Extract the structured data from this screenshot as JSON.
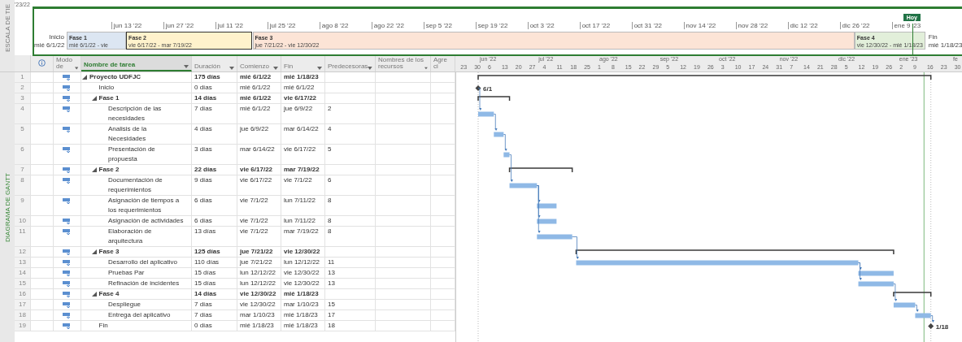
{
  "side_labels": {
    "timeline": "ESCALA DE TIE",
    "gantt": "DIAGRAMA DE GANTT"
  },
  "timeline": {
    "cut_label": "'23/22",
    "today": "Hoy",
    "ticks": [
      "jun 13 '22",
      "jun 27 '22",
      "jul 11 '22",
      "jul 25 '22",
      "ago 8 '22",
      "ago 22 '22",
      "sep 5 '22",
      "sep 19 '22",
      "oct 3 '22",
      "oct 17 '22",
      "oct 31 '22",
      "nov 14 '22",
      "nov 28 '22",
      "dic 12 '22",
      "dic 26 '22",
      "ene 9 '23"
    ],
    "start": {
      "label": "Inicio",
      "date": "mié 6/1/22"
    },
    "end": {
      "label": "Fin",
      "date": "mié 1/18/23"
    },
    "bars": [
      {
        "name": "Fase 1",
        "dates": "mié 6/1/22 - vie",
        "color": "#dce6f2",
        "selected": false
      },
      {
        "name": "Fase 2",
        "dates": "vie 6/17/22 - mar 7/19/22",
        "color": "#fff2cc",
        "selected": true
      },
      {
        "name": "Fase 3",
        "dates": "jue 7/21/22 - vie 12/30/22",
        "color": "#fce4d6",
        "selected": false
      },
      {
        "name": "Fase 4",
        "dates": "vie 12/30/22 - mié 1/18/23",
        "color": "#e2efda",
        "selected": false
      }
    ]
  },
  "columns": [
    {
      "kind": "info"
    },
    {
      "kind": "text",
      "label": "Modo de",
      "filter": true,
      "selected": false
    },
    {
      "kind": "text",
      "label": "Nombre de tarea",
      "filter": true,
      "selected": true
    },
    {
      "kind": "text",
      "label": "Duración",
      "filter": true,
      "selected": false
    },
    {
      "kind": "text",
      "label": "Comienzo",
      "filter": true,
      "selected": false
    },
    {
      "kind": "text",
      "label": "Fin",
      "filter": true,
      "selected": false
    },
    {
      "kind": "text",
      "label": "Predecesoras",
      "filter": true,
      "selected": false
    },
    {
      "kind": "text",
      "label": "Nombres de los recursos",
      "filter": true,
      "selected": false
    },
    {
      "kind": "text",
      "label": "Agre ci",
      "filter": false,
      "selected": false
    }
  ],
  "gantt_header": {
    "months": [
      "jun '22",
      "jul '22",
      "ago '22",
      "sep '22",
      "oct '22",
      "nov '22",
      "dic '22",
      "ene '23",
      "fe"
    ],
    "weeks": [
      "23",
      "30",
      "6",
      "13",
      "20",
      "27",
      "4",
      "11",
      "18",
      "25",
      "1",
      "8",
      "15",
      "22",
      "29",
      "5",
      "12",
      "19",
      "26",
      "3",
      "10",
      "17",
      "24",
      "31",
      "7",
      "14",
      "21",
      "28",
      "5",
      "12",
      "19",
      "26",
      "2",
      "9",
      "16",
      "23",
      "30"
    ]
  },
  "tasks": [
    {
      "id": "1",
      "name": "Proyecto UDFJC",
      "duration": "175 días",
      "start": "mié 6/1/22",
      "finish": "mié 1/18/23",
      "kind": "summary",
      "expanded": true,
      "children": [
        {
          "id": "2",
          "name": "Inicio",
          "duration": "0 días",
          "start": "mié 6/1/22",
          "finish": "mié 6/1/22",
          "kind": "milestone",
          "bar_label": "6/1"
        },
        {
          "id": "3",
          "name": "Fase 1",
          "duration": "14 días",
          "start": "mié 6/1/22",
          "finish": "vie 6/17/22",
          "kind": "summary",
          "expanded": true,
          "children": [
            {
              "id": "4",
              "name": "Descripción de las necesidades",
              "duration": "7 días",
              "start": "mié 6/1/22",
              "finish": "jue 6/9/22",
              "predecessors": "2",
              "kind": "task"
            },
            {
              "id": "5",
              "name": "Analisis de la Necesidades",
              "duration": "4 días",
              "start": "jue 6/9/22",
              "finish": "mar 6/14/22",
              "predecessors": "4",
              "kind": "task"
            },
            {
              "id": "6",
              "name": "Presentación de propuesta",
              "duration": "3 días",
              "start": "mar 6/14/22",
              "finish": "vie 6/17/22",
              "predecessors": "5",
              "kind": "task"
            }
          ]
        },
        {
          "id": "7",
          "name": "Fase 2",
          "duration": "22 días",
          "start": "vie 6/17/22",
          "finish": "mar 7/19/22",
          "kind": "summary",
          "expanded": true,
          "children": [
            {
              "id": "8",
              "name": "Documentación de requerimientos",
              "duration": "9 días",
              "start": "vie 6/17/22",
              "finish": "vie 7/1/22",
              "predecessors": "6",
              "kind": "task"
            },
            {
              "id": "9",
              "name": "Asignación de tiempos a los requerimientos",
              "duration": "6 días",
              "start": "vie 7/1/22",
              "finish": "lun 7/11/22",
              "predecessors": "8",
              "kind": "task"
            },
            {
              "id": "10",
              "name": "Asignación de actividades",
              "duration": "6 días",
              "start": "vie 7/1/22",
              "finish": "lun 7/11/22",
              "predecessors": "8",
              "kind": "task"
            },
            {
              "id": "11",
              "name": "Elaboración de arquitectura",
              "duration": "13 días",
              "start": "vie 7/1/22",
              "finish": "mar 7/19/22",
              "predecessors": "8",
              "kind": "task"
            }
          ]
        },
        {
          "id": "12",
          "name": "Fase 3",
          "duration": "125 días",
          "start": "jue 7/21/22",
          "finish": "vie 12/30/22",
          "kind": "summary",
          "expanded": true,
          "children": [
            {
              "id": "13",
              "name": "Desarrollo del aplicativo",
              "duration": "110 días",
              "start": "jue 7/21/22",
              "finish": "lun 12/12/22",
              "predecessors": "11",
              "kind": "task"
            },
            {
              "id": "14",
              "name": "Pruebas Par",
              "duration": "15 días",
              "start": "lun 12/12/22",
              "finish": "vie 12/30/22",
              "predecessors": "13",
              "kind": "task"
            },
            {
              "id": "15",
              "name": "Refinación de incidentes",
              "duration": "15 días",
              "start": "lun 12/12/22",
              "finish": "vie 12/30/22",
              "predecessors": "13",
              "kind": "task"
            }
          ]
        },
        {
          "id": "16",
          "name": "Fase 4",
          "duration": "14 días",
          "start": "vie 12/30/22",
          "finish": "mié 1/18/23",
          "kind": "summary",
          "expanded": true,
          "children": [
            {
              "id": "17",
              "name": "Despliegue",
              "duration": "7 días",
              "start": "vie 12/30/22",
              "finish": "mar 1/10/23",
              "predecessors": "15",
              "kind": "task"
            },
            {
              "id": "18",
              "name": "Entrega del aplicativo",
              "duration": "7 días",
              "start": "mar 1/10/23",
              "finish": "mié 1/18/23",
              "predecessors": "17",
              "kind": "task"
            }
          ]
        },
        {
          "id": "19",
          "name": "Fin",
          "duration": "0 días",
          "start": "mié 1/18/23",
          "finish": "mié 1/18/23",
          "predecessors": "18",
          "kind": "milestone",
          "bar_label": "1/18"
        }
      ]
    }
  ]
}
